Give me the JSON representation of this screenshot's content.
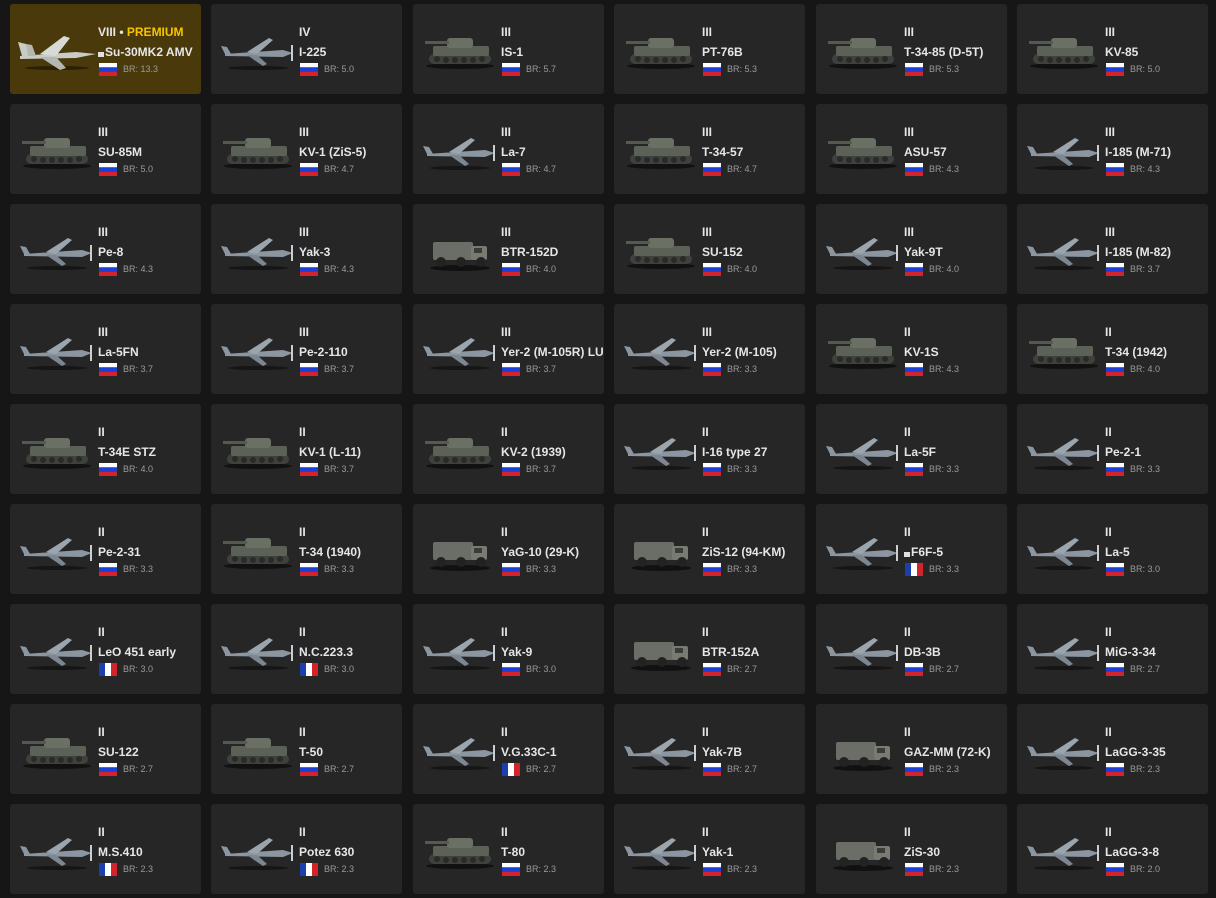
{
  "colors": {
    "page_bg": "#161616",
    "card_bg": "#262626",
    "premium_card_bg": "#4a3a0b",
    "premium_label": "#f7c400",
    "name_text": "#e6e6e6",
    "br_text": "#9a9a9a"
  },
  "vehicles": [
    {
      "tier": "VIII",
      "premium_label": "PREMIUM",
      "name": "Su-30MK2 AMV",
      "nation": "russia",
      "br": "BR: 13.3",
      "icon": "jet-icon",
      "marked": true
    },
    {
      "tier": "IV",
      "name": "I-225",
      "nation": "russia",
      "br": "BR: 5.0",
      "icon": "plane-icon"
    },
    {
      "tier": "III",
      "name": "IS-1",
      "nation": "russia",
      "br": "BR: 5.7",
      "icon": "tank-icon"
    },
    {
      "tier": "III",
      "name": "PT-76B",
      "nation": "russia",
      "br": "BR: 5.3",
      "icon": "tank-icon"
    },
    {
      "tier": "III",
      "name": "T-34-85 (D-5T)",
      "nation": "russia",
      "br": "BR: 5.3",
      "icon": "tank-icon"
    },
    {
      "tier": "III",
      "name": "KV-85",
      "nation": "russia",
      "br": "BR: 5.0",
      "icon": "tank-icon"
    },
    {
      "tier": "III",
      "name": "SU-85M",
      "nation": "russia",
      "br": "BR: 5.0",
      "icon": "tank-icon"
    },
    {
      "tier": "III",
      "name": "KV-1 (ZiS-5)",
      "nation": "russia",
      "br": "BR: 4.7",
      "icon": "tank-icon"
    },
    {
      "tier": "III",
      "name": "La-7",
      "nation": "russia",
      "br": "BR: 4.7",
      "icon": "plane-icon"
    },
    {
      "tier": "III",
      "name": "T-34-57",
      "nation": "russia",
      "br": "BR: 4.7",
      "icon": "tank-icon"
    },
    {
      "tier": "III",
      "name": "ASU-57",
      "nation": "russia",
      "br": "BR: 4.3",
      "icon": "tank-icon"
    },
    {
      "tier": "III",
      "name": "I-185 (M-71)",
      "nation": "russia",
      "br": "BR: 4.3",
      "icon": "plane-icon"
    },
    {
      "tier": "III",
      "name": "Pe-8",
      "nation": "russia",
      "br": "BR: 4.3",
      "icon": "plane-icon"
    },
    {
      "tier": "III",
      "name": "Yak-3",
      "nation": "russia",
      "br": "BR: 4.3",
      "icon": "plane-icon"
    },
    {
      "tier": "III",
      "name": "BTR-152D",
      "nation": "russia",
      "br": "BR: 4.0",
      "icon": "truck-icon"
    },
    {
      "tier": "III",
      "name": "SU-152",
      "nation": "russia",
      "br": "BR: 4.0",
      "icon": "tank-icon"
    },
    {
      "tier": "III",
      "name": "Yak-9T",
      "nation": "russia",
      "br": "BR: 4.0",
      "icon": "plane-icon"
    },
    {
      "tier": "III",
      "name": "I-185 (M-82)",
      "nation": "russia",
      "br": "BR: 3.7",
      "icon": "plane-icon"
    },
    {
      "tier": "III",
      "name": "La-5FN",
      "nation": "russia",
      "br": "BR: 3.7",
      "icon": "plane-icon"
    },
    {
      "tier": "III",
      "name": "Pe-2-110",
      "nation": "russia",
      "br": "BR: 3.7",
      "icon": "plane-icon"
    },
    {
      "tier": "III",
      "name": "Yer-2 (M-105R) LU",
      "nation": "russia",
      "br": "BR: 3.7",
      "icon": "plane-icon"
    },
    {
      "tier": "III",
      "name": "Yer-2 (M-105)",
      "nation": "russia",
      "br": "BR: 3.3",
      "icon": "plane-icon"
    },
    {
      "tier": "II",
      "name": "KV-1S",
      "nation": "russia",
      "br": "BR: 4.3",
      "icon": "tank-icon"
    },
    {
      "tier": "II",
      "name": "T-34 (1942)",
      "nation": "russia",
      "br": "BR: 4.0",
      "icon": "tank-icon"
    },
    {
      "tier": "II",
      "name": "T-34E STZ",
      "nation": "russia",
      "br": "BR: 4.0",
      "icon": "tank-icon"
    },
    {
      "tier": "II",
      "name": "KV-1 (L-11)",
      "nation": "russia",
      "br": "BR: 3.7",
      "icon": "tank-icon"
    },
    {
      "tier": "II",
      "name": "KV-2 (1939)",
      "nation": "russia",
      "br": "BR: 3.7",
      "icon": "tank-icon"
    },
    {
      "tier": "II",
      "name": "I-16 type 27",
      "nation": "russia",
      "br": "BR: 3.3",
      "icon": "plane-icon"
    },
    {
      "tier": "II",
      "name": "La-5F",
      "nation": "russia",
      "br": "BR: 3.3",
      "icon": "plane-icon"
    },
    {
      "tier": "II",
      "name": "Pe-2-1",
      "nation": "russia",
      "br": "BR: 3.3",
      "icon": "plane-icon"
    },
    {
      "tier": "II",
      "name": "Pe-2-31",
      "nation": "russia",
      "br": "BR: 3.3",
      "icon": "plane-icon"
    },
    {
      "tier": "II",
      "name": "T-34 (1940)",
      "nation": "russia",
      "br": "BR: 3.3",
      "icon": "tank-icon"
    },
    {
      "tier": "II",
      "name": "YaG-10 (29-K)",
      "nation": "russia",
      "br": "BR: 3.3",
      "icon": "truck-icon"
    },
    {
      "tier": "II",
      "name": "ZiS-12 (94-KM)",
      "nation": "russia",
      "br": "BR: 3.3",
      "icon": "truck-icon"
    },
    {
      "tier": "II",
      "name": "F6F-5",
      "nation": "france",
      "br": "BR: 3.3",
      "icon": "plane-icon",
      "marked": true
    },
    {
      "tier": "II",
      "name": "La-5",
      "nation": "russia",
      "br": "BR: 3.0",
      "icon": "plane-icon"
    },
    {
      "tier": "II",
      "name": "LeO 451 early",
      "nation": "france",
      "br": "BR: 3.0",
      "icon": "plane-icon"
    },
    {
      "tier": "II",
      "name": "N.C.223.3",
      "nation": "france",
      "br": "BR: 3.0",
      "icon": "plane-icon"
    },
    {
      "tier": "II",
      "name": "Yak-9",
      "nation": "russia",
      "br": "BR: 3.0",
      "icon": "plane-icon"
    },
    {
      "tier": "II",
      "name": "BTR-152A",
      "nation": "russia",
      "br": "BR: 2.7",
      "icon": "truck-icon"
    },
    {
      "tier": "II",
      "name": "DB-3B",
      "nation": "russia",
      "br": "BR: 2.7",
      "icon": "plane-icon"
    },
    {
      "tier": "II",
      "name": "MiG-3-34",
      "nation": "russia",
      "br": "BR: 2.7",
      "icon": "plane-icon"
    },
    {
      "tier": "II",
      "name": "SU-122",
      "nation": "russia",
      "br": "BR: 2.7",
      "icon": "tank-icon"
    },
    {
      "tier": "II",
      "name": "T-50",
      "nation": "russia",
      "br": "BR: 2.7",
      "icon": "tank-icon"
    },
    {
      "tier": "II",
      "name": "V.G.33C-1",
      "nation": "france",
      "br": "BR: 2.7",
      "icon": "plane-icon"
    },
    {
      "tier": "II",
      "name": "Yak-7B",
      "nation": "russia",
      "br": "BR: 2.7",
      "icon": "plane-icon"
    },
    {
      "tier": "II",
      "name": "GAZ-MM (72-K)",
      "nation": "russia",
      "br": "BR: 2.3",
      "icon": "truck-icon"
    },
    {
      "tier": "II",
      "name": "LaGG-3-35",
      "nation": "russia",
      "br": "BR: 2.3",
      "icon": "plane-icon"
    },
    {
      "tier": "II",
      "name": "M.S.410",
      "nation": "france",
      "br": "BR: 2.3",
      "icon": "plane-icon"
    },
    {
      "tier": "II",
      "name": "Potez 630",
      "nation": "france",
      "br": "BR: 2.3",
      "icon": "plane-icon"
    },
    {
      "tier": "II",
      "name": "T-80",
      "nation": "russia",
      "br": "BR: 2.3",
      "icon": "tank-icon"
    },
    {
      "tier": "II",
      "name": "Yak-1",
      "nation": "russia",
      "br": "BR: 2.3",
      "icon": "plane-icon"
    },
    {
      "tier": "II",
      "name": "ZiS-30",
      "nation": "russia",
      "br": "BR: 2.3",
      "icon": "truck-icon"
    },
    {
      "tier": "II",
      "name": "LaGG-3-8",
      "nation": "russia",
      "br": "BR: 2.0",
      "icon": "plane-icon"
    }
  ]
}
